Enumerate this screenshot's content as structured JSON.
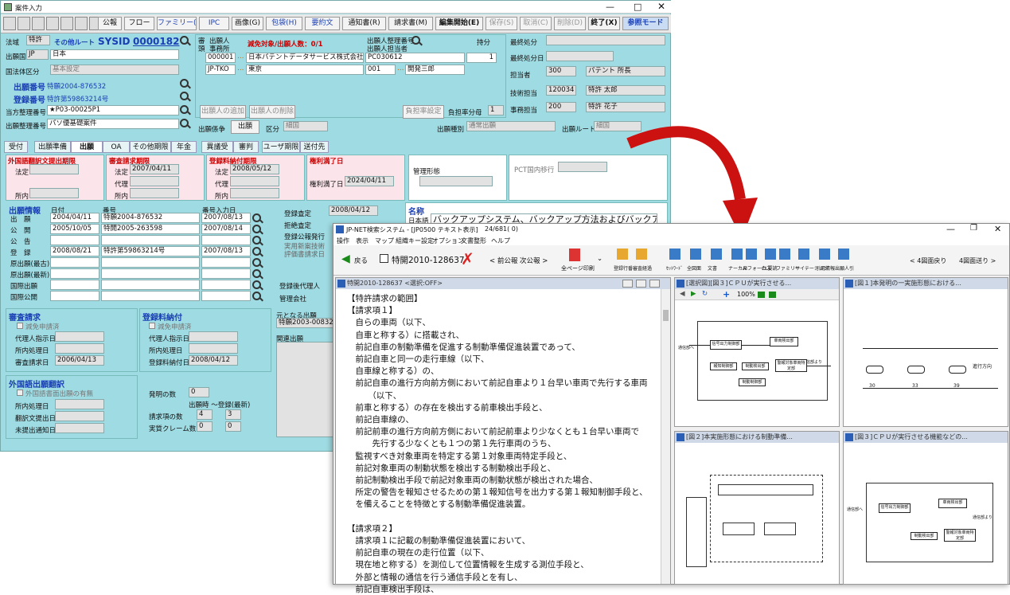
{
  "win1": {
    "title": "案件入力",
    "toolbar": [
      "公報",
      "フロー",
      "ファミリー(F)",
      "IPC",
      "画像(G)",
      "包袋(H)",
      "要約文",
      "通知書(R)",
      "請求書(M)",
      "編集開始(E)",
      "保存(S)",
      "取消(C)",
      "削除(D)",
      "終了(X)",
      "参照モード"
    ],
    "head": {
      "law_label": "法域",
      "law": "特許",
      "route": "その他ルート",
      "sysid_label": "SYSID",
      "sysid": "0000182",
      "country_label": "出願国",
      "country_code": "JP",
      "country": "日本",
      "entity_label": "国法体区分",
      "entity": "基本設定",
      "app_no_label": "出願番号",
      "app_no": "特願2004-876532",
      "reg_no_label": "登録番号",
      "reg_no": "特許第59863214号",
      "our_ref_label": "当方整理番号",
      "our_ref": "★P03-00025P1",
      "app_ref_label": "出願整理番号",
      "app_ref": "パソ優基礎案件"
    },
    "applicant": {
      "h1": "審",
      "h2": "頭",
      "col1": "出願人",
      "col2": "事務所",
      "exempt": "減免対象/出願人数：0/1",
      "col3": "出願人整理番号",
      "col3b": "出願人担当者",
      "share": "持分",
      "r1_code": "000001",
      "r1_name": "日本パテントデータサービス株式会社",
      "r1_ref": "PC030612",
      "r1_share": "1",
      "r2_code": "JP-TKO",
      "r2_name": "東京",
      "r2_ref": "001",
      "r2_person": "開発三郎",
      "add": "出願人の追加",
      "del": "出願人の削除",
      "burden_set": "負担率設定",
      "burden_label": "負担率分母",
      "burden": "1"
    },
    "right": {
      "final": "最終処分",
      "final_date": "最終処分日",
      "charge": "担当者",
      "charge_code": "300",
      "charge_name": "パテント 所長",
      "tech": "技術担当",
      "tech_code": "120034",
      "tech_name": "特許 太郎",
      "office": "事務担当",
      "office_code": "200",
      "office_name": "特許 花子"
    },
    "rel": {
      "label": "出願係争",
      "btn": "出願",
      "kubun": "区分",
      "kubun_val": "細国",
      "type": "出願種別",
      "type_val": "通常出願",
      "route": "出願ルート",
      "route_val": "細国"
    },
    "tabs": [
      "受付",
      "出願準備",
      "出願",
      "OA",
      "その他期限",
      "年金",
      "異議受",
      "審判",
      "ユーザ期限",
      "送付先"
    ],
    "deadlines": [
      {
        "title": "外国語翻訳文提出期限",
        "r1": "法定",
        "r2": "所内"
      },
      {
        "title": "審査請求期限",
        "r1": "法定",
        "v1": "2007/04/11",
        "r2": "代理",
        "r3": "所内"
      },
      {
        "title": "登録料納付期限",
        "r1": "法定",
        "v1": "2008/05/12",
        "r2": "代理",
        "r3": "所内"
      },
      {
        "title": "権利満了日",
        "r1": "権利満了日",
        "v1": "2024/04/11"
      }
    ],
    "mgmt": "管理形態",
    "pct": "PCT国内移行",
    "appinfo": {
      "title": "出願情報",
      "c1": "日付",
      "c2": "番号",
      "c3": "番号入力日",
      "rows": [
        [
          "出　願",
          "2004/04/11",
          "特願2004-876532",
          "2007/08/13"
        ],
        [
          "公　開",
          "2005/10/05",
          "特開2005-263598",
          "2007/08/14"
        ],
        [
          "公　告",
          "",
          "",
          ""
        ],
        [
          "登　録",
          "2008/08/21",
          "特許第59863214号",
          "2007/08/13"
        ],
        [
          "原出願(最古)",
          "",
          "",
          ""
        ],
        [
          "原出願(最新)",
          "",
          "",
          ""
        ],
        [
          "国際出願",
          "",
          "",
          ""
        ],
        [
          "国際公開",
          "",
          "",
          ""
        ]
      ]
    },
    "reg": {
      "l1": "登録査定",
      "v1": "2008/04/12",
      "l2": "拒絶査定",
      "l3": "登録公報発行",
      "l4": "実用新案技術",
      "l5": "評価書請求日"
    },
    "name": {
      "label": "名称",
      "lang": "日本語",
      "value": "バックアップシステム、バックアップ方法およびバックアッププログラム"
    },
    "agent": {
      "l1": "登録後代理人",
      "l2": "管理会社"
    },
    "exam": {
      "title": "審査請求",
      "cb": "減免申請済",
      "l1": "代理人指示日",
      "l2": "所内処理日",
      "l3": "審査請求日",
      "v3": "2006/04/13"
    },
    "fee": {
      "title": "登録料納付",
      "cb": "減免申請済",
      "l1": "代理人指示日",
      "l2": "所内処理日",
      "l3": "登録料納付日",
      "v3": "2008/04/12"
    },
    "orig": {
      "l1": "元となる出願",
      "v1": "特願2003-008325",
      "l2": "関連出願"
    },
    "trans": {
      "title": "外国語出願翻訳",
      "cb": "外国語書面出願の有無",
      "l1": "所内処理日",
      "l2": "翻訳文提出日",
      "l3": "未提出通知日"
    },
    "inv": {
      "l1": "発明の数",
      "v1": "0",
      "l2": "出願時 〜登録(最新)",
      "l3": "請求項の数",
      "v3a": "4",
      "v3b": "3",
      "l4": "実質クレーム数",
      "v4a": "0",
      "v4b": "0"
    }
  },
  "win2": {
    "title": "JP-NET検索システム - [JP0500 テキスト表示]",
    "pages": "24/681( 0)",
    "menu": [
      "操作",
      "表示",
      "マップ",
      "組織キー設定",
      "オプション",
      "文書整形",
      "ヘルプ"
    ],
    "back": "戻る",
    "doc": "特開2010-128637",
    "prevnext": "< 前公報 次公報 >",
    "print": "全ページ印刷",
    "tools": [
      "登録行番",
      "審査経過",
      "ｾｯﾄﾜｰﾄﾞ",
      "全図面",
      "文書",
      "ナーカス",
      "AIフォーカス",
      "CL要読",
      "ファミリー",
      "サイテーション",
      "引用情報",
      "出願人引"
    ],
    "figprev": "< 4図面戻り",
    "fignext": "4図面送り >",
    "text_pane": "特開2010-128637 <選択:OFF>",
    "claims": [
      "【特許請求の範囲】",
      "【請求項１】",
      "　自らの車両（以下、",
      "　自車と称する）に搭載され、",
      "　前記自車の制動準備を促進する制動準備促進装置であって、",
      "　前記自車と同一の走行車線（以下、",
      "　自車線と称する）の、",
      "　前記自車の進行方向前方側において前記自車より１台早い車両で先行する車両",
      "　　　（以下、",
      "　前車と称する）の存在を検出する前車検出手段と、",
      "　前記自車線の、",
      "　前記前車の進行方向前方側において前記前車より少なくとも１台早い車両で",
      "　　　先行する少なくとも１つの第１先行車両のうち、",
      "　監視すべき対象車両を特定する第１対象車両特定手段と、",
      "　前記対象車両の制動状態を検出する制動検出手段と、",
      "　前記制動検出手段で前記対象車両の制動状態が検出された場合、",
      "　所定の警告を報知させるための第１報知信号を出力する第１報知制御手段と、",
      "　を備えることを特徴とする制動準備促進装置。",
      "",
      "【請求項２】",
      "　請求項１に記載の制動準備促進装置において、",
      "　前記自車の現在の走行位置（以下、",
      "　現在地と称する）を測位して位置情報を生成する測位手段と、",
      "　外部と情報の通信を行う通信手段とを有し、",
      "　前記自車検出手段は、"
    ],
    "fig_panes": [
      "[選択図][図３]ＣＰＵが実行させる...",
      "[図１]本発明の一実施形態における...",
      "[図２]本実施形態における制動準備...",
      "[図３]ＣＰＵが実行させる機能などの..."
    ],
    "zoom": "100%",
    "fig1": {
      "in": "通信部へ",
      "out": "通信部より",
      "b1": "信号出力制御部",
      "b2": "制動制御部",
      "b3": "車両検出部",
      "b4": "報知制御部",
      "b5": "制動検出部",
      "b6": "警報対象車両特定部"
    },
    "fig2": {
      "dir": "進行方向",
      "n1": "30",
      "n2": "33",
      "n3": "39"
    },
    "fig4": {
      "in": "通信部へ",
      "out": "通信部より",
      "b1": "信号出力制御部",
      "b3": "車両検出部",
      "b5": "制動検出部",
      "b6": "警報対象車両特定部"
    },
    "colors": {
      "form_bg": "#9fdbe2",
      "blue_text": "#1a3fb5",
      "red_text": "#cc0000",
      "arrow": "#cc1111"
    }
  }
}
